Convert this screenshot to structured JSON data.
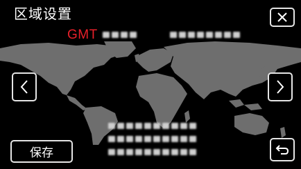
{
  "header": {
    "title": "区域设置"
  },
  "timezone": {
    "gmt_label": "GMT"
  },
  "footer": {
    "save_label": "保存"
  },
  "icons": {
    "close": "close-icon",
    "prev": "chevron-left-icon",
    "next": "chevron-right-icon",
    "return": "return-icon"
  },
  "colors": {
    "background": "#000000",
    "map_land": "#6e6e6e",
    "gmt_text": "#e8202a",
    "button_border": "#e6e6e6"
  }
}
